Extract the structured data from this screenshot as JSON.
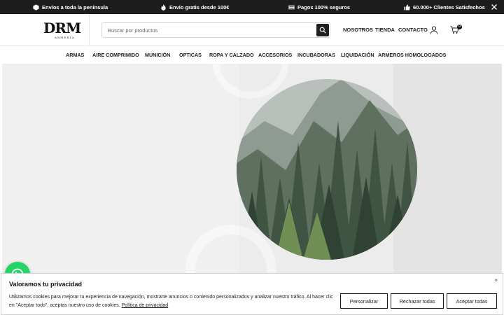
{
  "topbar": {
    "items": [
      {
        "icon": "box-icon",
        "label": "Envíos a toda la península"
      },
      {
        "icon": "fire-icon",
        "label": "Envío gratis desde 100€"
      },
      {
        "icon": "card-icon",
        "label": "Pagos 100% seguros"
      },
      {
        "icon": "thumbs-up-icon",
        "label": "60.000+ Clientes Satisfechos"
      }
    ]
  },
  "header": {
    "logo_text": "DRM",
    "logo_subtext": "ARMERIA",
    "search_placeholder": "Buscar por productos",
    "nav": [
      "NOSOTROS",
      "TIENDA",
      "CONTACTO"
    ],
    "cart_count": "0"
  },
  "categories": [
    "ARMAS",
    "AIRE COMPRIMIDO",
    "MUNICIÓN",
    "OPTICAS",
    "ROPA Y CALZADO",
    "ACCESORIOS",
    "INCUBADORAS",
    "LIQUIDACIÓN",
    "ARMEROS HOMOLOGADOS"
  ],
  "cookie": {
    "title": "Valoramos tu privacidad",
    "text": "Utilizamos cookies para mejorar tu experiencia de navegación, mostrarte anuncios o contenido personalizados y analizar nuestro tráfico. Al hacer clic en \"Aceptar todo\", aceptas nuestro uso de cookies.",
    "policy_link": "Política de privacidad",
    "close": "×",
    "buttons": [
      "Personalizar",
      "Rechazar todas",
      "Aceptar todas"
    ]
  },
  "colors": {
    "topbar": "#1d1d1d",
    "whatsapp": "#25d366",
    "hero_bg": "#ececec"
  }
}
